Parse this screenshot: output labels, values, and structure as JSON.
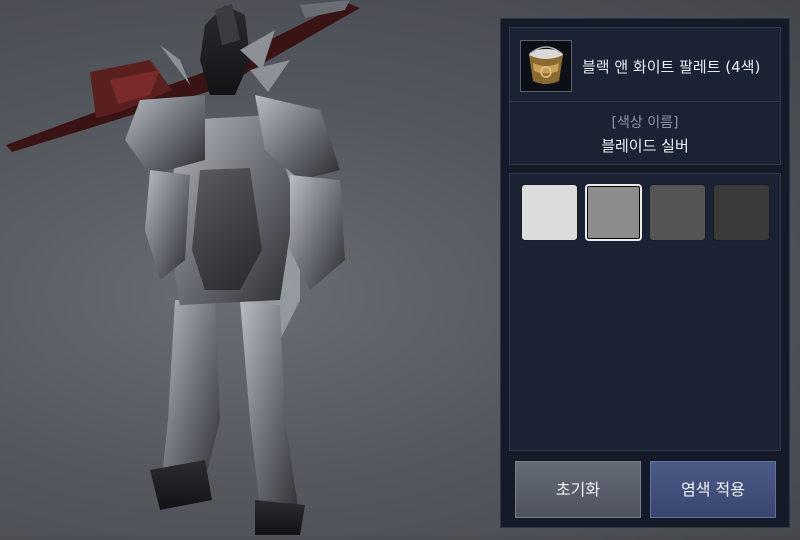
{
  "item": {
    "icon": "dye-bucket-icon",
    "title": "블랙 앤 화이트 팔레트 (4색)"
  },
  "color_name": {
    "label": "[색상 이름]",
    "value": "블레이드 실버"
  },
  "swatches": [
    {
      "color": "#dcdcdc",
      "selected": false
    },
    {
      "color": "#8c8c8c",
      "selected": true
    },
    {
      "color": "#555555",
      "selected": false
    },
    {
      "color": "#3a3a3a",
      "selected": false
    }
  ],
  "buttons": {
    "reset_label": "초기화",
    "apply_label": "염색 적용"
  }
}
